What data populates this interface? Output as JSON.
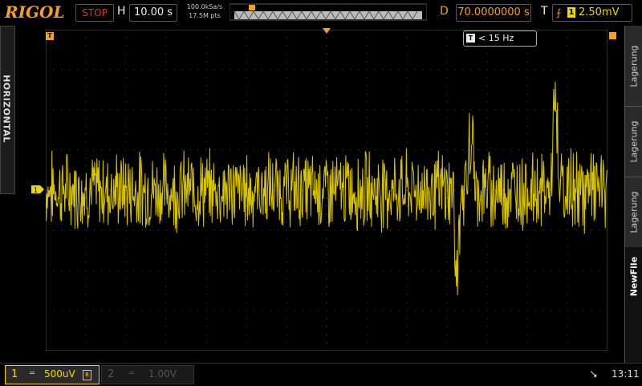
{
  "brand": "RIGOL",
  "status": "STOP",
  "horizontal": {
    "label": "H",
    "timebase": "10.00 s",
    "sample_rate": "100.0kSa/s",
    "memory_depth": "17.5M pts",
    "side_label": "HORIZONTAL"
  },
  "delay": {
    "label": "D",
    "value": "70.0000000 s"
  },
  "trigger": {
    "label": "T",
    "channel": "1",
    "slope_icon": "rising-edge-icon",
    "level": "2.50mV"
  },
  "frequency_readout": {
    "badge": "T",
    "value": "< 15 Hz"
  },
  "channel1_marker": "1",
  "menu": {
    "items": [
      "Lagerung",
      "Lagerung",
      "Lagerung",
      "NewFile"
    ]
  },
  "channels": [
    {
      "number": "1",
      "coupling_icon": "dc-coupling-icon",
      "scale": "500uV",
      "bw_limit": "B",
      "active": true,
      "color": "#f0d800"
    },
    {
      "number": "2",
      "coupling_icon": "dc-coupling-icon",
      "scale": "1.00V",
      "active": false,
      "color": "#555555"
    }
  ],
  "usb_icon": "usb-icon",
  "time": "13:11",
  "colors": {
    "accent": "#f4a020",
    "trace": "#f0d800",
    "stop": "#e03030"
  },
  "chart_data": {
    "type": "line",
    "title": "",
    "xlabel": "",
    "ylabel": "",
    "grid": true,
    "divisions": {
      "x": 14,
      "y": 8
    },
    "series": [
      {
        "name": "",
        "color": "#f0d800",
        "baseline_div": -0.0,
        "noise_amplitude_div": 0.8,
        "events": [
          {
            "x_div": 10.25,
            "type": "dip",
            "depth_div": -2.6
          },
          {
            "x_div": 10.6,
            "type": "peak",
            "height_div": 1.8
          },
          {
            "x_div": 12.7,
            "type": "peak",
            "height_div": 2.8
          }
        ]
      }
    ]
  }
}
